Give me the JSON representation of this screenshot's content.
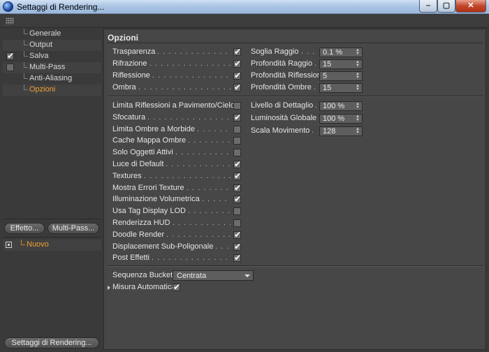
{
  "window": {
    "title": "Settaggi di Rendering...",
    "min": "‒",
    "max": "▢",
    "close": "✕"
  },
  "tree": [
    {
      "label": "Generale",
      "checked": false,
      "has_check": false,
      "active": false
    },
    {
      "label": "Output",
      "checked": false,
      "has_check": false,
      "active": false
    },
    {
      "label": "Salva",
      "checked": true,
      "has_check": true,
      "active": false
    },
    {
      "label": "Multi-Pass",
      "checked": false,
      "has_check": true,
      "active": false
    },
    {
      "label": "Anti-Aliasing",
      "checked": false,
      "has_check": false,
      "active": false
    },
    {
      "label": "Opzioni",
      "checked": false,
      "has_check": false,
      "active": true
    }
  ],
  "buttons": {
    "effetto": "Effetto...",
    "multipass": "Multi-Pass...",
    "settaggi": "Settaggi di Rendering..."
  },
  "preset": {
    "label": "Nuovo"
  },
  "panel": {
    "title": "Opzioni"
  },
  "options_top": [
    {
      "label": "Trasparenza",
      "checked": true
    },
    {
      "label": "Rifrazione",
      "checked": true
    },
    {
      "label": "Riflessione",
      "checked": true
    },
    {
      "label": "Ombra",
      "checked": true
    }
  ],
  "fields_top": [
    {
      "label": "Soglia Raggio",
      "value": "0.1 %"
    },
    {
      "label": "Profondità Raggio",
      "value": "15"
    },
    {
      "label": "Profondità Riflessione",
      "value": "5"
    },
    {
      "label": "Profondità Ombre",
      "value": "15"
    }
  ],
  "options_main": [
    {
      "label": "Limita Riflessioni a Pavimento/Cielo",
      "checked": false
    },
    {
      "label": "Sfocatura",
      "checked": true
    },
    {
      "label": "Limita Ombre a Morbide",
      "checked": false
    },
    {
      "label": "Cache Mappa Ombre",
      "checked": false
    },
    {
      "label": "Solo Oggetti Attivi",
      "checked": false
    },
    {
      "label": "Luce di Default",
      "checked": true
    },
    {
      "label": "Textures",
      "checked": true
    },
    {
      "label": "Mostra Errori Texture",
      "checked": true
    },
    {
      "label": "Illuminazione Volumetrica",
      "checked": true
    },
    {
      "label": "Usa Tag Display LOD",
      "checked": false
    },
    {
      "label": "Renderizza HUD",
      "checked": false
    },
    {
      "label": "Doodle Render",
      "checked": true
    },
    {
      "label": "Displacement Sub-Poligonale",
      "checked": true
    },
    {
      "label": "Post Effetti",
      "checked": true
    }
  ],
  "fields_main": [
    {
      "label": "Livello di Dettaglio",
      "value": "100 %"
    },
    {
      "label": "Luminosità Globale",
      "value": "100 %"
    },
    {
      "label": "Scala Movimento",
      "value": "128"
    }
  ],
  "bucket": {
    "label": "Sequenza Bucket",
    "value": "Centrata"
  },
  "auto_size": {
    "label": "Misura Automatica",
    "checked": true
  },
  "check_glyph": "✔"
}
